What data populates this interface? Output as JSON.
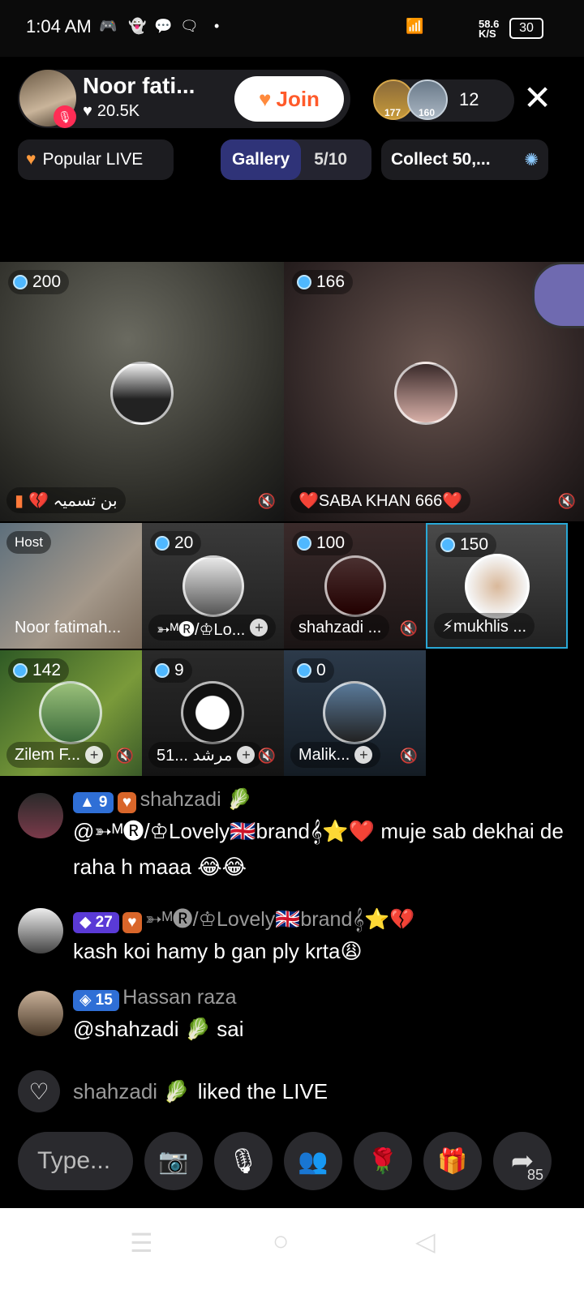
{
  "status": {
    "time": "1:04 AM",
    "speed": "58.6",
    "speed_unit": "K/S",
    "battery": "30"
  },
  "host": {
    "name": "Noor fati...",
    "likes": "20.5K",
    "join_label": "Join"
  },
  "viewers": {
    "badge1": "177",
    "badge2": "160",
    "count": "12"
  },
  "chips": {
    "popular": "Popular LIVE",
    "gallery": "Gallery",
    "gallery_progress": "5/10",
    "collect": "Collect 50,..."
  },
  "grid": {
    "tile1": {
      "score": "200",
      "name": "بن تسمیہ 💔"
    },
    "tile2": {
      "score": "166",
      "name": "❤️SABA KHAN 666❤️"
    },
    "tile3": {
      "host_label": "Host",
      "name": "Noor fatimah..."
    },
    "tile4": {
      "score": "20",
      "name": "➳ᴹ🅡/♔Lo..."
    },
    "tile5": {
      "score": "100",
      "name": "shahzadi ..."
    },
    "tile6": {
      "score": "150",
      "name": "⚡mukhlis ..."
    },
    "tile7": {
      "score": "142",
      "name": "Zilem F..."
    },
    "tile8": {
      "score": "9",
      "name": "مرشد ...51"
    },
    "tile9": {
      "score": "0",
      "name": "Malik..."
    }
  },
  "chat": [
    {
      "level": "9",
      "user": "shahzadi 🥬",
      "text": "@➳ᴹ🅡/♔Lovely🇬🇧brand𝄞⭐❤️ muje sab dekhai de raha h maaa 😂😂"
    },
    {
      "level": "27",
      "user": "➳ᴹ🅡/♔Lovely🇬🇧brand𝄞⭐💔",
      "text": "kash koi hamy b gan ply krta😩"
    },
    {
      "level": "15",
      "user": "Hassan raza",
      "text": "@shahzadi 🥬 sai"
    }
  ],
  "liked": {
    "user": "shahzadi 🥬",
    "text": "liked the LIVE"
  },
  "toolbar": {
    "placeholder": "Type...",
    "share_count": "85"
  }
}
